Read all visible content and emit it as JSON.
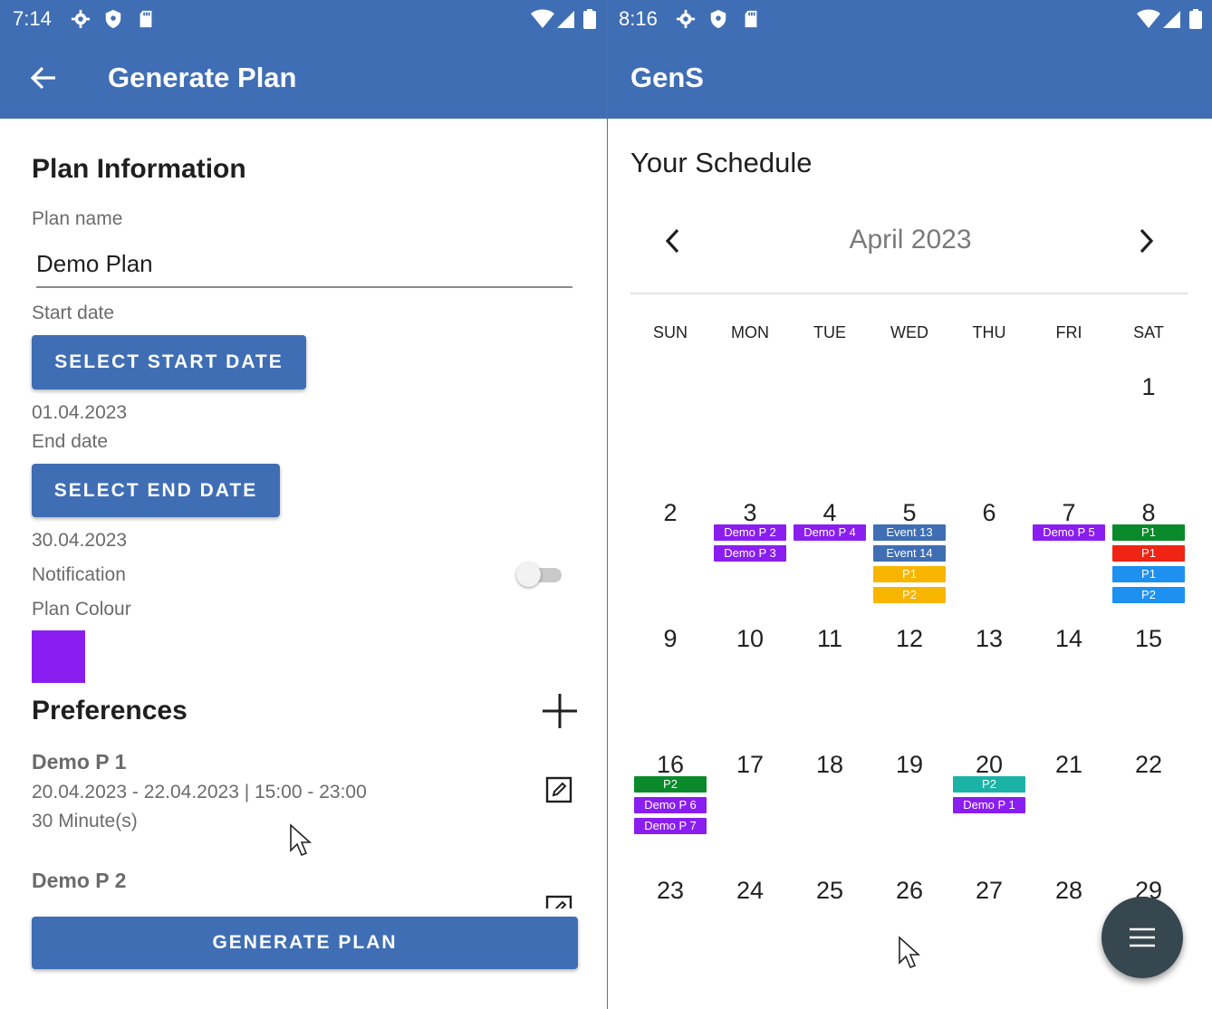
{
  "left": {
    "status_time": "7:14",
    "appbar_title": "Generate Plan",
    "section_title": "Plan Information",
    "plan_name_label": "Plan name",
    "plan_name_value": "Demo Plan",
    "start_date_label": "Start date",
    "select_start_label": "SELECT START DATE",
    "start_date_value": "01.04.2023",
    "end_date_label": "End date",
    "select_end_label": "SELECT END DATE",
    "end_date_value": "30.04.2023",
    "notification_label": "Notification",
    "notification_on": false,
    "plan_colour_label": "Plan Colour",
    "plan_colour": "#8a1ef0",
    "preferences_title": "Preferences",
    "preferences": [
      {
        "name": "Demo P 1",
        "range": "20.04.2023 - 22.04.2023 | 15:00 - 23:00",
        "duration": "30 Minute(s)"
      },
      {
        "name": "Demo P 2",
        "range": "",
        "duration": ""
      }
    ],
    "generate_label": "GENERATE PLAN"
  },
  "right": {
    "status_time": "8:16",
    "appbar_title": "GenS",
    "schedule_title": "Your Schedule",
    "month_label": "April 2023",
    "weekdays": [
      "SUN",
      "MON",
      "TUE",
      "WED",
      "THU",
      "FRI",
      "SAT"
    ],
    "weeks": [
      [
        "",
        "",
        "",
        "",
        "",
        "",
        "1"
      ],
      [
        "2",
        "3",
        "4",
        "5",
        "6",
        "7",
        "8"
      ],
      [
        "9",
        "10",
        "11",
        "12",
        "13",
        "14",
        "15"
      ],
      [
        "16",
        "17",
        "18",
        "19",
        "20",
        "21",
        "22"
      ],
      [
        "23",
        "24",
        "25",
        "26",
        "27",
        "28",
        "29"
      ]
    ],
    "events": {
      "3": [
        {
          "label": "Demo P 2",
          "color": "#8a1ef0"
        },
        {
          "label": "Demo P 3",
          "color": "#8a1ef0"
        }
      ],
      "4": [
        {
          "label": "Demo P 4",
          "color": "#8a1ef0"
        }
      ],
      "5": [
        {
          "label": "Event 13",
          "color": "#3f6eb4"
        },
        {
          "label": "Event 14",
          "color": "#3f6eb4"
        },
        {
          "label": "P1",
          "color": "#f7b500"
        },
        {
          "label": "P2",
          "color": "#f7b500"
        }
      ],
      "7": [
        {
          "label": "Demo P 5",
          "color": "#8a1ef0"
        }
      ],
      "8": [
        {
          "label": "P1",
          "color": "#0a8a2a"
        },
        {
          "label": "P1",
          "color": "#f02414"
        },
        {
          "label": "P1",
          "color": "#1e90f0"
        },
        {
          "label": "P2",
          "color": "#1e90f0"
        }
      ],
      "16": [
        {
          "label": "P2",
          "color": "#0a8a2a"
        },
        {
          "label": "Demo P 6",
          "color": "#8a1ef0"
        },
        {
          "label": "Demo P 7",
          "color": "#8a1ef0"
        }
      ],
      "20": [
        {
          "label": "P2",
          "color": "#1ab3a6"
        },
        {
          "label": "Demo P 1",
          "color": "#8a1ef0"
        }
      ]
    }
  },
  "colors": {
    "primary": "#3f6eb4",
    "fab": "#37474f"
  }
}
